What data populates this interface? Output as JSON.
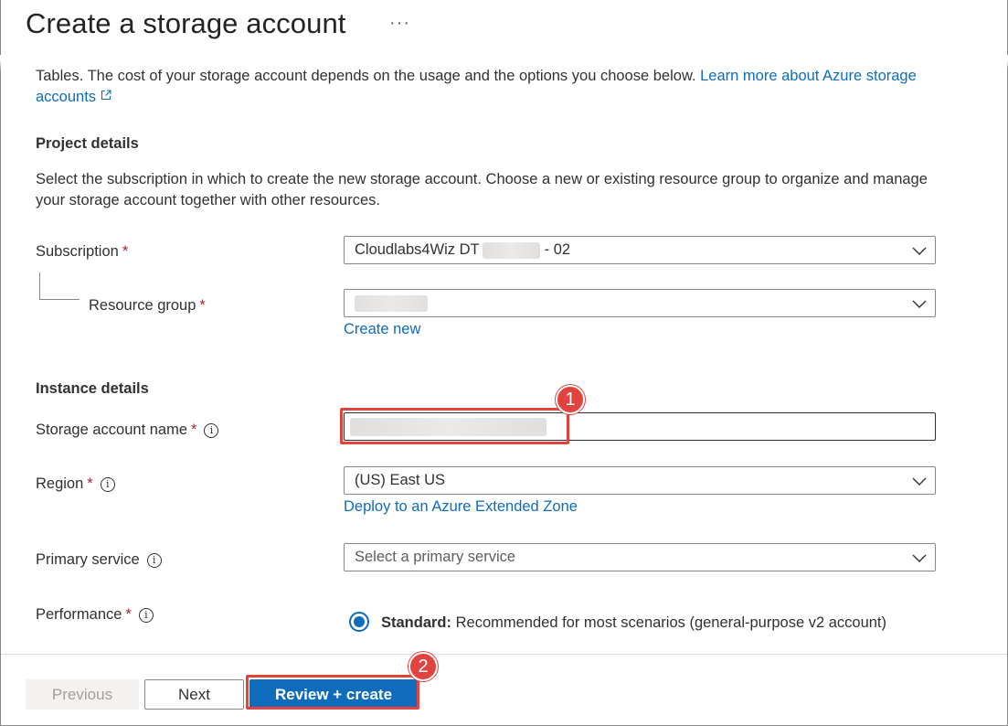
{
  "header": {
    "title": "Create a storage account",
    "more_label": "···"
  },
  "intro": {
    "text": "Tables. The cost of your storage account depends on the usage and the options you choose below.",
    "link": "Learn more about Azure storage accounts"
  },
  "project_details": {
    "heading": "Project details",
    "description": "Select the subscription in which to create the new storage account. Choose a new or existing resource group to organize and manage your storage account together with other resources.",
    "subscription": {
      "label": "Subscription",
      "value_prefix": "Cloudlabs4Wiz DT",
      "value_suffix": "- 02"
    },
    "resource_group": {
      "label": "Resource group",
      "create_new": "Create new"
    }
  },
  "instance_details": {
    "heading": "Instance details",
    "storage_account_name": {
      "label": "Storage account name"
    },
    "region": {
      "label": "Region",
      "value": "(US) East US",
      "extended_zone_link": "Deploy to an Azure Extended Zone"
    },
    "primary_service": {
      "label": "Primary service",
      "placeholder": "Select a primary service"
    },
    "performance": {
      "label": "Performance",
      "option_bold": "Standard:",
      "option_desc": "Recommended for most scenarios (general-purpose v2 account)"
    }
  },
  "required_mark": "*",
  "info_glyph": "i",
  "annotations": {
    "badge1": "1",
    "badge2": "2",
    "color": "#e2433f"
  },
  "footer": {
    "previous": "Previous",
    "next": "Next",
    "review_create": "Review + create"
  },
  "colors": {
    "accent": "#0f6cbd",
    "text": "#323130",
    "required": "#a4262c"
  }
}
